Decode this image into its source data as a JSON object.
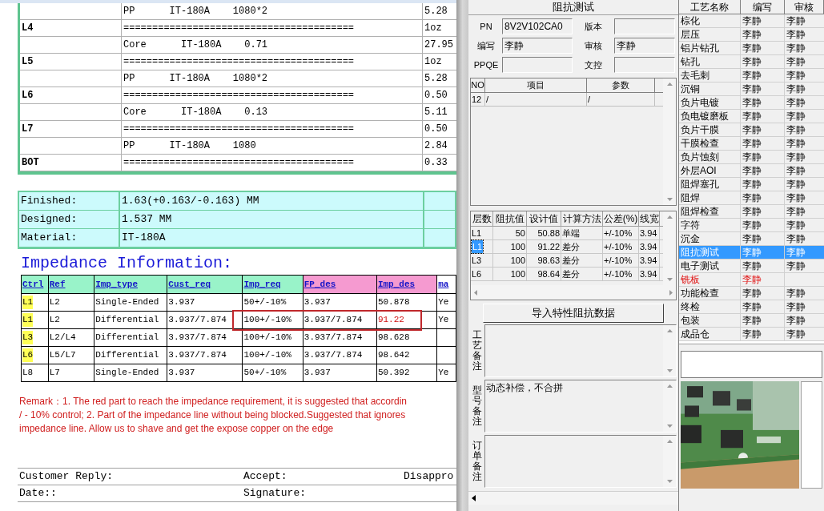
{
  "stackup": {
    "rows": [
      {
        "layer": "",
        "material": "PP      IT-180A    1080*2",
        "thickness": "5.28"
      },
      {
        "layer": "L4",
        "material": "========================================",
        "thickness": "1oz"
      },
      {
        "layer": "",
        "material": "Core      IT-180A    0.71",
        "thickness": "27.95"
      },
      {
        "layer": "L5",
        "material": "========================================",
        "thickness": "1oz"
      },
      {
        "layer": "",
        "material": "PP      IT-180A    1080*2",
        "thickness": "5.28"
      },
      {
        "layer": "L6",
        "material": "========================================",
        "thickness": "0.50"
      },
      {
        "layer": "",
        "material": "Core      IT-180A    0.13",
        "thickness": "5.11"
      },
      {
        "layer": "L7",
        "material": "========================================",
        "thickness": "0.50"
      },
      {
        "layer": "",
        "material": "PP      IT-180A    1080",
        "thickness": "2.84"
      },
      {
        "layer": "BOT",
        "material": "========================================",
        "thickness": "0.33"
      }
    ]
  },
  "summary": [
    {
      "label": "Finished:",
      "value": "1.63(+0.163/-0.163) MM"
    },
    {
      "label": "Designed:",
      "value": "1.537 MM"
    },
    {
      "label": "Material:",
      "value": "IT-180A"
    }
  ],
  "impedance": {
    "heading": "Impedance Information:",
    "columns": [
      {
        "label": "Ctrl",
        "color": "#99f3c9"
      },
      {
        "label": "Ref",
        "color": "#99f3c9"
      },
      {
        "label": "Imp_type",
        "color": "#99f3c9"
      },
      {
        "label": "Cust_req",
        "color": "#99f3c9"
      },
      {
        "label": "Imp_req",
        "color": "#99f3c9"
      },
      {
        "label": "FP_des",
        "color": "#f59ad0"
      },
      {
        "label": "Imp_des",
        "color": "#f59ad0"
      },
      {
        "label": "ma",
        "color": "#ffffff"
      }
    ],
    "rows": [
      {
        "highlighted": true,
        "cells": [
          "L1",
          "L2",
          "Single-Ended",
          "3.937",
          "50+/-10%",
          "3.937",
          "50.878",
          "Ye"
        ],
        "flagged": false,
        "outlined": false
      },
      {
        "highlighted": true,
        "cells": [
          "L1",
          "L2",
          "Differential",
          "3.937/7.874",
          "100+/-10%",
          "3.937/7.874",
          "91.22",
          "Ye"
        ],
        "flagged": true,
        "outlined": true
      },
      {
        "highlighted": true,
        "cells": [
          "L3",
          "L2/L4",
          "Differential",
          "3.937/7.874",
          "100+/-10%",
          "3.937/7.874",
          "98.628"
        ],
        "flagged": false,
        "outlined": false
      },
      {
        "highlighted": true,
        "cells": [
          "L6",
          "L5/L7",
          "Differential",
          "3.937/7.874",
          "100+/-10%",
          "3.937/7.874",
          "98.642"
        ],
        "flagged": false,
        "outlined": false
      },
      {
        "highlighted": false,
        "cells": [
          "L8",
          "L7",
          "Single-Ended",
          "3.937",
          "50+/-10%",
          "3.937",
          "50.392",
          "Ye"
        ],
        "flagged": false,
        "outlined": false
      }
    ]
  },
  "remark": [
    "Remark：1. The red part to reach the impedance requirement, it is suggested that accordin",
    "/ - 10% control; 2. Part of the impedance line without being blocked.Suggested that ignores",
    "impedance line. Allow us to shave and get the expose copper on the edge"
  ],
  "reply_rows": [
    [
      "Customer Reply:",
      "Accept:",
      "Disappro"
    ],
    [
      "Date::",
      "Signature:"
    ]
  ],
  "test_panel": {
    "title": "阻抗测试",
    "fields": [
      {
        "label": "PN",
        "value": "8V2V102CA0"
      },
      {
        "label": "版本"
      },
      {
        "label": "编写",
        "value": "李静"
      },
      {
        "label": "审核",
        "value": "李静"
      },
      {
        "label": "PPQE"
      },
      {
        "label": "文控"
      }
    ],
    "items_grid": {
      "columns": [
        "NO",
        "项目",
        "参数"
      ],
      "rows": [
        [
          "12",
          "/",
          "/"
        ]
      ]
    },
    "imp_grid": {
      "columns": [
        "层数",
        "阻抗值",
        "设计值",
        "计算方法",
        "公差(%)",
        "线宽"
      ],
      "rows": [
        {
          "cells": [
            "L1",
            "50",
            "50.88",
            "单端",
            "+/-10%",
            "3.94"
          ],
          "selected": false
        },
        {
          "cells": [
            "L1",
            "100",
            "91.22",
            "差分",
            "+/-10%",
            "3.94"
          ],
          "selected": true
        },
        {
          "cells": [
            "L3",
            "100",
            "98.63",
            "差分",
            "+/-10%",
            "3.94"
          ],
          "selected": false
        },
        {
          "cells": [
            "L6",
            "100",
            "98.64",
            "差分",
            "+/-10%",
            "3.94"
          ],
          "selected": false
        }
      ]
    },
    "import_button": "导入特性阻抗数据",
    "notes": [
      {
        "label": "工艺备注"
      },
      {
        "label": "型号备注",
        "value": "动态补偿，不合拼"
      },
      {
        "label": "订单备注"
      }
    ]
  },
  "process_grid": {
    "columns": [
      "工艺名称",
      "编写",
      "审核"
    ],
    "rows": [
      {
        "name": "棕化",
        "writer": "李静",
        "reviewer": "李静",
        "selected": false,
        "flagged": false
      },
      {
        "name": "层压",
        "writer": "李静",
        "reviewer": "李静",
        "selected": false,
        "flagged": false
      },
      {
        "name": "铝片钻孔",
        "writer": "李静",
        "reviewer": "李静",
        "selected": false,
        "flagged": false
      },
      {
        "name": "钻孔",
        "writer": "李静",
        "reviewer": "李静",
        "selected": false,
        "flagged": false
      },
      {
        "name": "去毛刺",
        "writer": "李静",
        "reviewer": "李静",
        "selected": false,
        "flagged": false
      },
      {
        "name": "沉铜",
        "writer": "李静",
        "reviewer": "李静",
        "selected": false,
        "flagged": false
      },
      {
        "name": "负片电镀",
        "writer": "李静",
        "reviewer": "李静",
        "selected": false,
        "flagged": false
      },
      {
        "name": "负电镀磨板",
        "writer": "李静",
        "reviewer": "李静",
        "selected": false,
        "flagged": false
      },
      {
        "name": "负片干膜",
        "writer": "李静",
        "reviewer": "李静",
        "selected": false,
        "flagged": false
      },
      {
        "name": "干膜检查",
        "writer": "李静",
        "reviewer": "李静",
        "selected": false,
        "flagged": false
      },
      {
        "name": "负片蚀刻",
        "writer": "李静",
        "reviewer": "李静",
        "selected": false,
        "flagged": false
      },
      {
        "name": "外层AOI",
        "writer": "李静",
        "reviewer": "李静",
        "selected": false,
        "flagged": false
      },
      {
        "name": "阻焊塞孔",
        "writer": "李静",
        "reviewer": "李静",
        "selected": false,
        "flagged": false
      },
      {
        "name": "阻焊",
        "writer": "李静",
        "reviewer": "李静",
        "selected": false,
        "flagged": false
      },
      {
        "name": "阻焊检查",
        "writer": "李静",
        "reviewer": "李静",
        "selected": false,
        "flagged": false
      },
      {
        "name": "字符",
        "writer": "李静",
        "reviewer": "李静",
        "selected": false,
        "flagged": false
      },
      {
        "name": "沉金",
        "writer": "李静",
        "reviewer": "李静",
        "selected": false,
        "flagged": false
      },
      {
        "name": "阻抗测试",
        "writer": "李静",
        "reviewer": "李静",
        "selected": true,
        "flagged": false
      },
      {
        "name": "电子测试",
        "writer": "李静",
        "reviewer": "李静",
        "selected": false,
        "flagged": false
      },
      {
        "name": "铣板",
        "writer": "李静",
        "selected": false,
        "flagged": true
      },
      {
        "name": "功能检查",
        "writer": "李静",
        "reviewer": "李静",
        "selected": false,
        "flagged": false
      },
      {
        "name": "终检",
        "writer": "李静",
        "reviewer": "李静",
        "selected": false,
        "flagged": false
      },
      {
        "name": "包装",
        "writer": "李静",
        "reviewer": "李静",
        "selected": false,
        "flagged": false
      },
      {
        "name": "成品仓",
        "writer": "李静",
        "reviewer": "李静",
        "selected": false,
        "flagged": false
      }
    ]
  },
  "photo": {
    "kind": "picture"
  }
}
